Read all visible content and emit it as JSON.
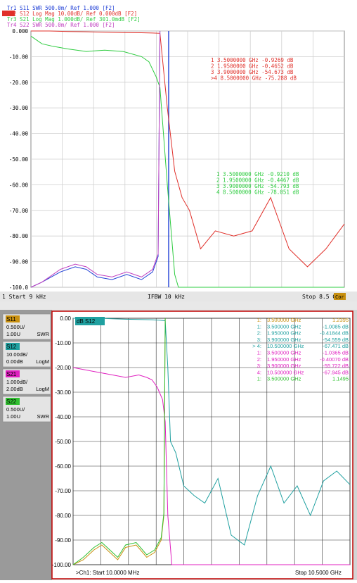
{
  "chart_data": [
    {
      "type": "line",
      "panel": "top",
      "trace_headers": [
        {
          "text": "Tr1 S11 SWR 500.0m/ Ref 1.000 [F2]",
          "color": "#1f3fd6"
        },
        {
          "text": "Tr2 S12 Log Mag 10.00dB/ Ref 0.000dB [F2]",
          "color": "#e0302a",
          "active": true
        },
        {
          "text": "Tr3 S21 Log Mag 1.000dB/ Ref 301.0mdB [F2]",
          "color": "#2ecc40"
        },
        {
          "text": "Tr4 S22 SWR 500.0m/ Ref 1.000 [F2]",
          "color": "#c040c0"
        }
      ],
      "y_ticks": [
        "0.000",
        "-10.00",
        "-20.00",
        "-30.00",
        "-40.00",
        "-50.00",
        "-60.00",
        "-70.00",
        "-80.00",
        "-90.00",
        "-100.0"
      ],
      "ylim": [
        -100,
        0
      ],
      "xlim_ghz": [
        9e-06,
        8.5
      ],
      "grid": true,
      "bottom_bar": {
        "start": "1  Start 9 kHz",
        "ifbw": "IFBW 10 kHz",
        "stop": "Stop 8.5 GHz",
        "cor": "Cor"
      },
      "marker_table_red": [
        "1   3.5000000 GHz -0.9269 dB",
        "2   1.9500000 GHz -0.4652 dB",
        "3   3.9000000 GHz -54.673 dB",
        ">4  8.5000000 GHz -75.288 dB"
      ],
      "marker_table_green": [
        "1   3.5000000 GHz -0.9210 dB",
        "2   1.9500000 GHz -0.4467 dB",
        "3   3.9000000 GHz -54.793 dB",
        "4   8.5000000 GHz -78.051 dB"
      ],
      "series": [
        {
          "name": "S12",
          "color": "#e0302a",
          "x": [
            0,
            0.5,
            1.0,
            1.5,
            2.0,
            2.5,
            3.0,
            3.3,
            3.5,
            3.7,
            3.9,
            4.1,
            4.3,
            4.6,
            5.0,
            5.5,
            6.0,
            6.5,
            7.0,
            7.5,
            8.0,
            8.5
          ],
          "y": [
            0,
            0,
            -0.2,
            -0.3,
            -0.5,
            -0.6,
            -0.7,
            -0.8,
            -0.9,
            -30,
            -54.7,
            -65,
            -70,
            -85,
            -78,
            -80,
            -78,
            -65,
            -85,
            -92,
            -85,
            -75.3
          ]
        },
        {
          "name": "S21",
          "color": "#2ecc40",
          "x": [
            0,
            0.3,
            0.6,
            1.0,
            1.5,
            2.0,
            2.5,
            3.0,
            3.2,
            3.4,
            3.5,
            3.7,
            3.9,
            4.0,
            8.5
          ],
          "y": [
            -2,
            -5,
            -6,
            -7,
            -8,
            -7.5,
            -8,
            -10,
            -12,
            -18,
            -22,
            -60,
            -95,
            -100,
            -100
          ]
        },
        {
          "name": "S11",
          "color": "#1f3fd6",
          "x": [
            0,
            0.3,
            0.8,
            1.2,
            1.5,
            1.8,
            2.2,
            2.6,
            3.0,
            3.3,
            3.45,
            3.5
          ],
          "y": [
            -100,
            -98,
            -94,
            -92,
            -93,
            -96,
            -97,
            -95,
            -97,
            -94,
            -88,
            0
          ]
        },
        {
          "name": "S22",
          "color": "#c040c0",
          "x": [
            0,
            0.3,
            0.8,
            1.2,
            1.5,
            1.8,
            2.2,
            2.6,
            3.0,
            3.3,
            3.45,
            3.5
          ],
          "y": [
            -100,
            -98,
            -93,
            -91,
            -92,
            -95,
            -96,
            -94,
            -96,
            -93,
            -87,
            0
          ]
        }
      ]
    },
    {
      "type": "line",
      "panel": "bottom",
      "legend": [
        {
          "name": "S11",
          "color": "#c89010",
          "line1": "0.500U/",
          "line2": "1.00U",
          "fmt": "SWR"
        },
        {
          "name": "S12",
          "color": "#20a0a0",
          "line1": "10.00dB/",
          "line2": "0.00dB",
          "fmt": "LogM"
        },
        {
          "name": "S21",
          "color": "#e020c0",
          "line1": "1.000dB/",
          "line2": "2.00dB",
          "fmt": "LogM"
        },
        {
          "name": "S22",
          "color": "#30c030",
          "line1": "0.500U/",
          "line2": "1.00U",
          "fmt": "SWR"
        }
      ],
      "tag": "dB S12",
      "y_ticks": [
        "0.00",
        "-10.00",
        "-20.00",
        "-30.00",
        "-40.00",
        "-50.00",
        "-60.00",
        "-70.00",
        "-80.00",
        "-90.00",
        "-100.00"
      ],
      "ylim": [
        -100,
        0
      ],
      "xlim_ghz": [
        0.01,
        10.5
      ],
      "grid": true,
      "bottom_bar": {
        "start": ">Ch1: Start  10.0000 MHz",
        "stop": "Stop  10.5000 GHz"
      },
      "marker_table": [
        {
          "idx": "1:",
          "freq": "3.500000 GHz",
          "val": "1.2395",
          "color": "#c89010"
        },
        {
          "idx": "1:",
          "freq": "3.500000 GHz",
          "val": "-1.0085 dB",
          "color": "#20a0a0"
        },
        {
          "idx": "2:",
          "freq": "1.950000 GHz",
          "val": "-0.41844 dB",
          "color": "#20a0a0"
        },
        {
          "idx": "3:",
          "freq": "3.900000 GHz",
          "val": "-54.559 dB",
          "color": "#20a0a0"
        },
        {
          "idx": "> 4:",
          "freq": "10.500000 GHz",
          "val": "-67.471 dB",
          "color": "#20a0a0"
        },
        {
          "idx": "1:",
          "freq": "3.500000 GHz",
          "val": "-1.0365 dB",
          "color": "#e020c0"
        },
        {
          "idx": "2:",
          "freq": "1.950000 GHz",
          "val": "-0.40070 dB",
          "color": "#e020c0"
        },
        {
          "idx": "3:",
          "freq": "3.900000 GHz",
          "val": "-55.722 dB",
          "color": "#e020c0"
        },
        {
          "idx": "4:",
          "freq": "10.500000 GHz",
          "val": "-67.945 dB",
          "color": "#e020c0"
        },
        {
          "idx": "1:",
          "freq": "3.500000 GHz",
          "val": "1.1495",
          "color": "#30c030"
        }
      ],
      "series": [
        {
          "name": "S12",
          "color": "#20a0a0",
          "x": [
            0.01,
            0.5,
            1.0,
            1.5,
            2.0,
            2.5,
            3.0,
            3.3,
            3.5,
            3.6,
            3.7,
            3.9,
            4.2,
            4.6,
            5.0,
            5.5,
            6.0,
            6.5,
            7.0,
            7.5,
            8.0,
            8.5,
            9.0,
            9.5,
            10.0,
            10.5
          ],
          "y": [
            0,
            0,
            0,
            -0.2,
            -0.4,
            -0.5,
            -0.6,
            -0.8,
            -1.0,
            -20,
            -50,
            -54.6,
            -68,
            -72,
            -75,
            -65,
            -88,
            -92,
            -72,
            -60,
            -75,
            -68,
            -80,
            -66,
            -62,
            -67.5
          ]
        },
        {
          "name": "S21",
          "color": "#e020c0",
          "x": [
            0.01,
            0.5,
            1.0,
            1.5,
            2.0,
            2.5,
            2.8,
            3.0,
            3.2,
            3.4,
            3.5,
            3.6,
            3.75,
            3.9,
            10.5
          ],
          "y": [
            -20,
            -21,
            -22,
            -23,
            -24,
            -23,
            -24,
            -25,
            -28,
            -33,
            -42,
            -80,
            -100,
            -100,
            -100
          ]
        },
        {
          "name": "S11",
          "color": "#c89010",
          "x": [
            0.01,
            0.4,
            0.8,
            1.1,
            1.4,
            1.7,
            2.0,
            2.4,
            2.8,
            3.1,
            3.35,
            3.45,
            3.5
          ],
          "y": [
            -100,
            -98,
            -94,
            -92,
            -95,
            -98,
            -93,
            -92,
            -97,
            -95,
            -90,
            -80,
            0
          ]
        },
        {
          "name": "S22",
          "color": "#30c030",
          "x": [
            0.01,
            0.4,
            0.8,
            1.1,
            1.4,
            1.7,
            2.0,
            2.4,
            2.8,
            3.1,
            3.35,
            3.45,
            3.5
          ],
          "y": [
            -100,
            -97,
            -93,
            -91,
            -94,
            -97,
            -92,
            -91,
            -96,
            -94,
            -89,
            -79,
            0
          ]
        }
      ]
    }
  ]
}
